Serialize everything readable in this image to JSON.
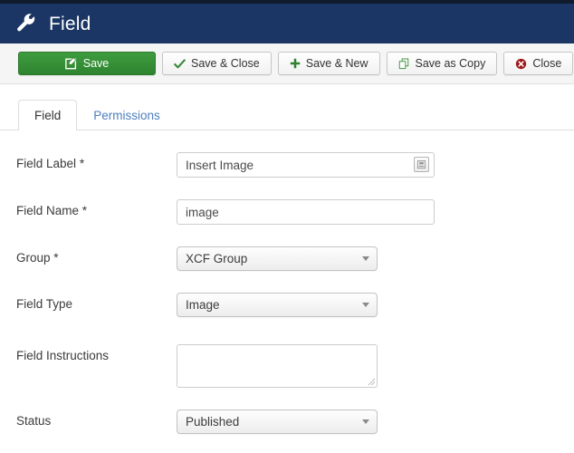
{
  "header": {
    "title": "Field",
    "icon": "wrench-icon",
    "bg_color": "#1b3664",
    "text_color": "#ffffff"
  },
  "toolbar": {
    "buttons": [
      {
        "label": "Save",
        "icon": "edit-square-icon",
        "style": "primary-green",
        "color": "#2f8430"
      },
      {
        "label": "Save & Close",
        "icon": "check-icon",
        "style": "default",
        "color": "#3a8a3a"
      },
      {
        "label": "Save & New",
        "icon": "plus-icon",
        "style": "default",
        "color": "#2f8430"
      },
      {
        "label": "Save as Copy",
        "icon": "copy-icon",
        "style": "default",
        "color": "#4f9d4f"
      },
      {
        "label": "Close",
        "icon": "close-circle-icon",
        "style": "default",
        "color": "#9e1b1b"
      }
    ]
  },
  "tabs": [
    {
      "label": "Field",
      "active": true
    },
    {
      "label": "Permissions",
      "active": false
    }
  ],
  "form": {
    "rows": [
      {
        "label": "Field Label",
        "required": true,
        "type": "text",
        "value": "Insert Image",
        "placeholder": "",
        "button_icon": "insert-field-icon"
      },
      {
        "label": "Field Name",
        "required": true,
        "type": "text",
        "value": "image",
        "placeholder": ""
      },
      {
        "label": "Group",
        "required": true,
        "type": "select",
        "value": "XCF Group"
      },
      {
        "label": "Field Type",
        "required": false,
        "type": "select",
        "value": "Image"
      },
      {
        "label": "Field Instructions",
        "required": false,
        "type": "textarea",
        "value": ""
      },
      {
        "label": "Status",
        "required": false,
        "type": "select",
        "value": "Published"
      }
    ],
    "required_marker": "*"
  }
}
